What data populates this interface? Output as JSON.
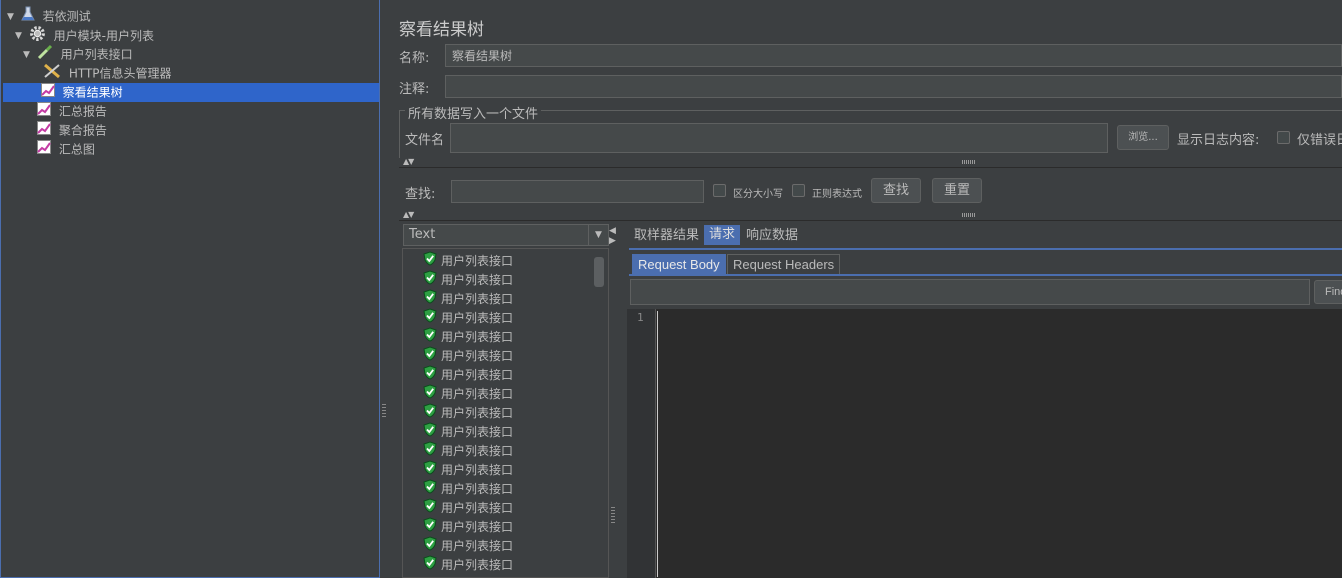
{
  "tree": {
    "items": [
      {
        "label": "若依测试",
        "icon": "flask-icon",
        "toggle": "▼"
      },
      {
        "label": "用户模块-用户列表",
        "icon": "gear-icon",
        "toggle": "▼"
      },
      {
        "label": "用户列表接口",
        "icon": "pipette-icon",
        "toggle": "▼"
      },
      {
        "label": "HTTP信息头管理器",
        "icon": "wrench-icon",
        "toggle": ""
      },
      {
        "label": "察看结果树",
        "icon": "graph-icon",
        "toggle": "",
        "selected": true
      },
      {
        "label": "汇总报告",
        "icon": "graph-icon",
        "toggle": ""
      },
      {
        "label": "聚合报告",
        "icon": "graph-icon",
        "toggle": ""
      },
      {
        "label": "汇总图",
        "icon": "graph-icon",
        "toggle": ""
      }
    ]
  },
  "panel": {
    "title": "察看结果树",
    "name_label": "名称:",
    "name_value": "察看结果树",
    "comment_label": "注释:",
    "comment_value": "",
    "file_group_title": "所有数据写入一个文件",
    "filename_label": "文件名",
    "filename_value": "",
    "browse_label": "浏览...",
    "log_content_label": "显示日志内容:",
    "errors_only_label": "仅错误日"
  },
  "search": {
    "label": "查找:",
    "value": "",
    "case_sensitive_label": "区分大小写",
    "regex_label": "正则表达式",
    "find_label": "查找",
    "reset_label": "重置"
  },
  "results": {
    "renderer": "Text",
    "items": [
      "用户列表接口",
      "用户列表接口",
      "用户列表接口",
      "用户列表接口",
      "用户列表接口",
      "用户列表接口",
      "用户列表接口",
      "用户列表接口",
      "用户列表接口",
      "用户列表接口",
      "用户列表接口",
      "用户列表接口",
      "用户列表接口",
      "用户列表接口",
      "用户列表接口",
      "用户列表接口",
      "用户列表接口"
    ],
    "status_color": "#2ea043"
  },
  "tabs": {
    "sampler_result": "取样器结果",
    "request": "请求",
    "response_data": "响应数据",
    "active": "request"
  },
  "inner_tabs": {
    "request_body": "Request Body",
    "request_headers": "Request Headers",
    "active": "request_body"
  },
  "editor": {
    "find_label": "Find",
    "line_number": "1",
    "content": ""
  },
  "colors": {
    "background": "#3c3f41",
    "selection": "#2f65ca",
    "accent": "#4b6eaf",
    "editor_bg": "#2b2b2b"
  }
}
